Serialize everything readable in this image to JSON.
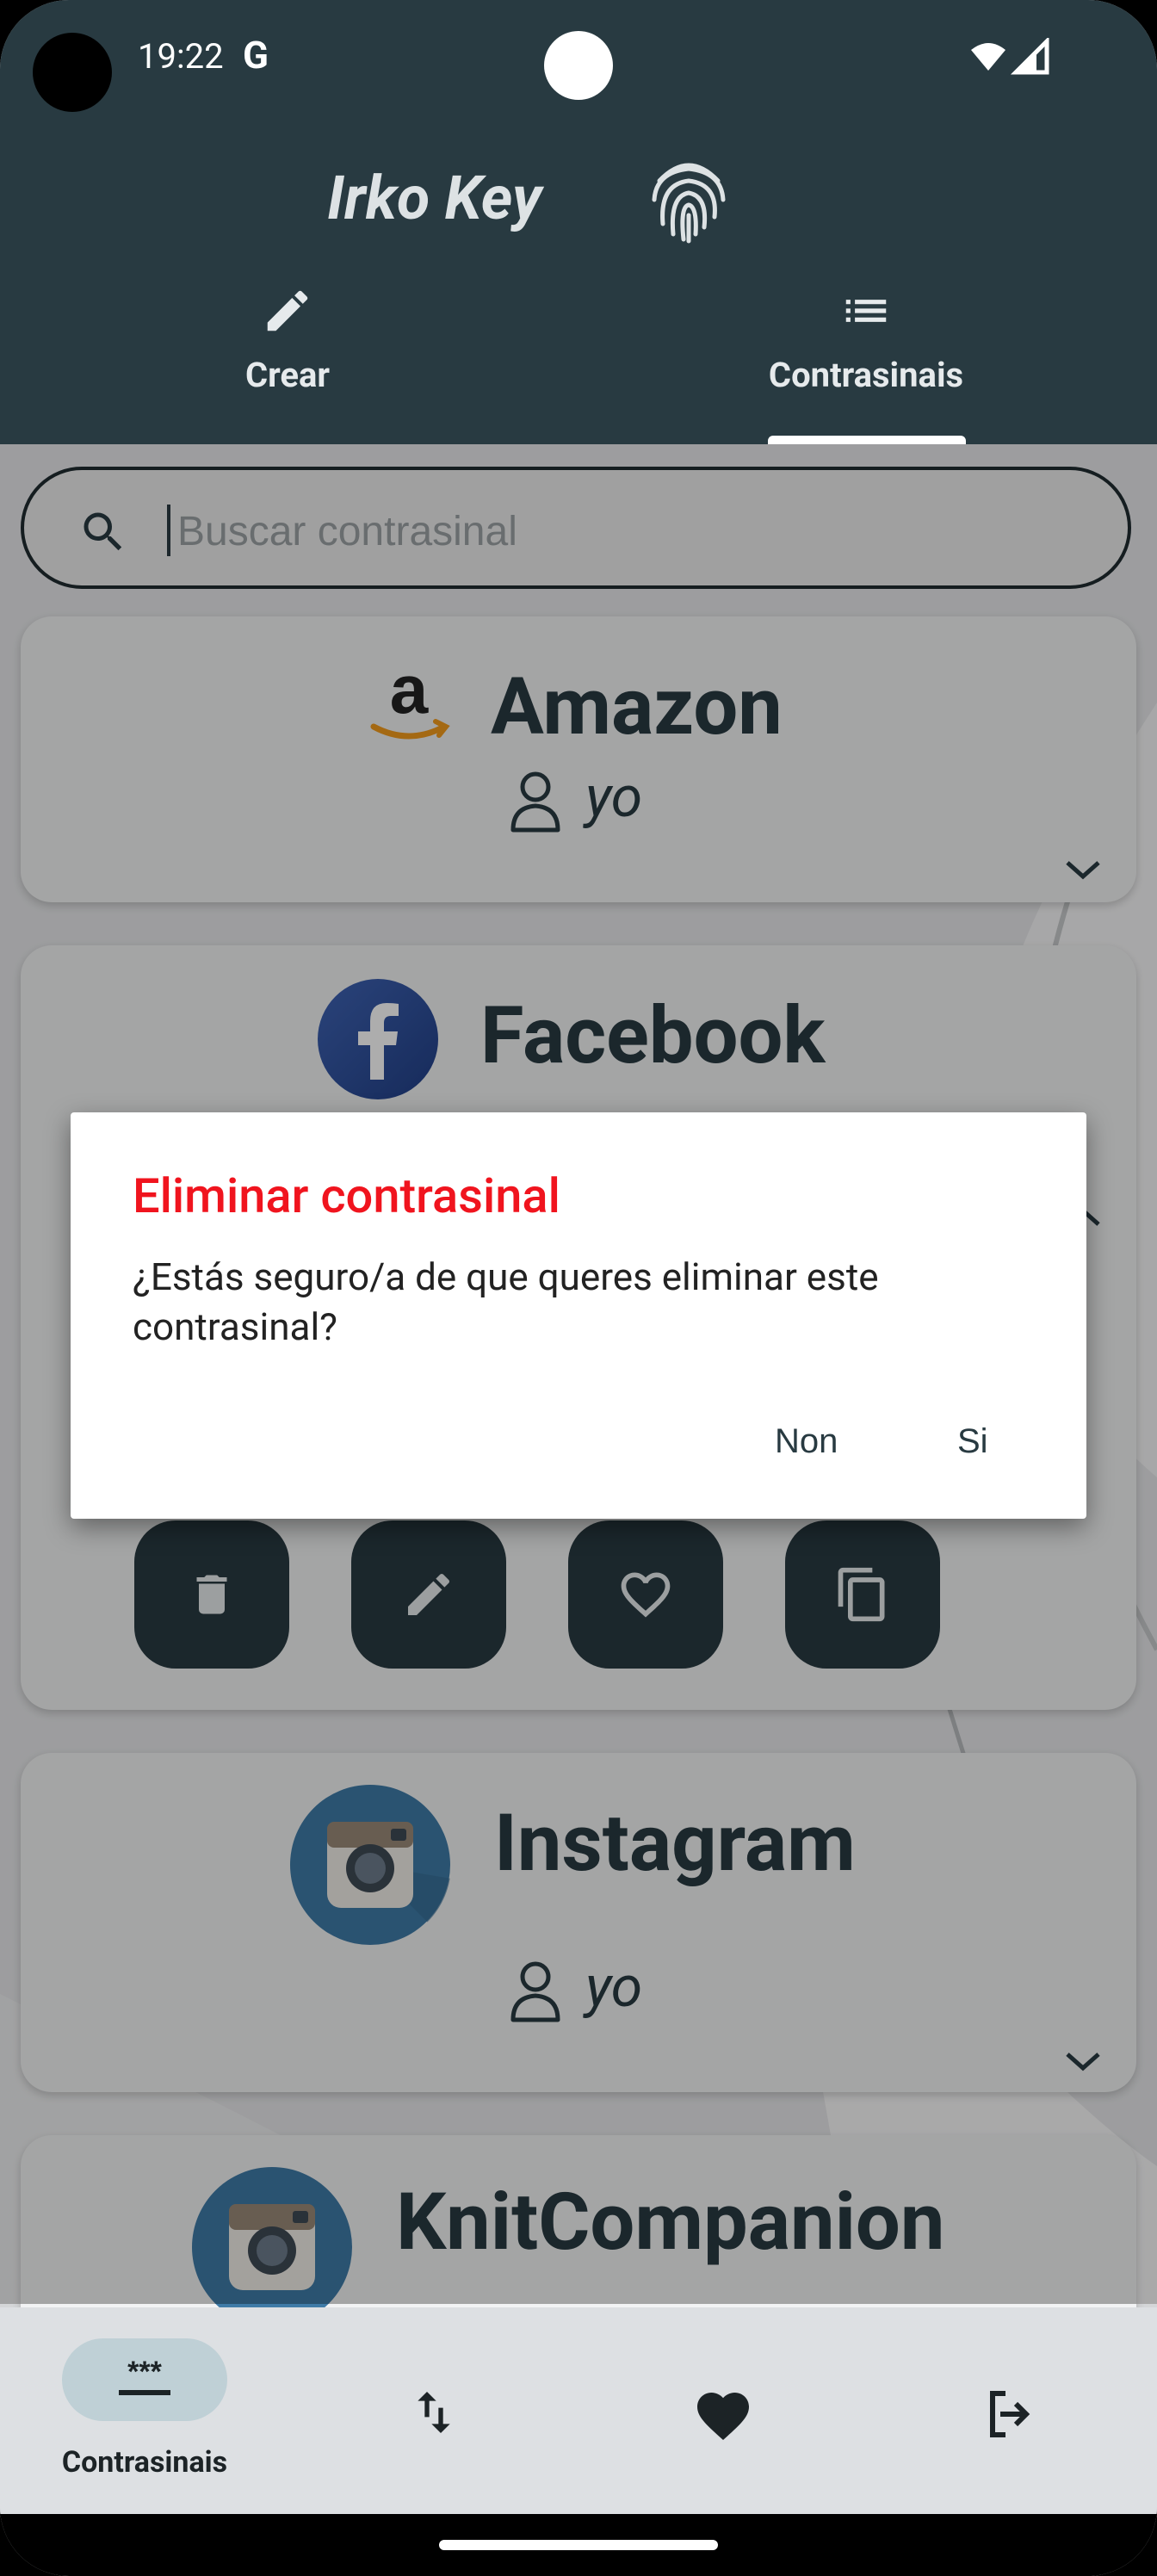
{
  "status_bar": {
    "time": "19:22",
    "google_glyph": "G"
  },
  "app": {
    "title": "Irko Key"
  },
  "top_tabs": [
    {
      "label": "Crear",
      "icon": "pencil-icon"
    },
    {
      "label": "Contrasinais",
      "icon": "list-icon",
      "selected": true
    }
  ],
  "search": {
    "placeholder": "Buscar contrasinal",
    "value": ""
  },
  "cards": [
    {
      "title": "Amazon",
      "user": "yo",
      "logo": "amazon-logo",
      "expanded": false
    },
    {
      "title": "Facebook",
      "user": "",
      "logo": "facebook-logo",
      "expanded": true
    },
    {
      "title": "Instagram",
      "user": "yo",
      "logo": "instagram-logo",
      "expanded": false
    },
    {
      "title": "KnitCompanion",
      "user": "",
      "logo": "instagram-logo",
      "expanded": false
    }
  ],
  "card_actions": [
    "delete-icon",
    "edit-icon",
    "favorite-icon",
    "copy-icon"
  ],
  "dialog": {
    "title": "Eliminar contrasinal",
    "message": "¿Estás seguro/a de que queres eliminar este contrasinal?",
    "cancel_label": "Non",
    "confirm_label": "Si",
    "title_color": "#f0141e"
  },
  "bottom_nav": {
    "active_label": "Contrasinais",
    "items": [
      "password-icon",
      "sort-icon",
      "heart-icon",
      "logout-icon"
    ]
  },
  "colors": {
    "primary": "#283a41",
    "card": "#f2f3f4",
    "danger": "#f0141e"
  }
}
